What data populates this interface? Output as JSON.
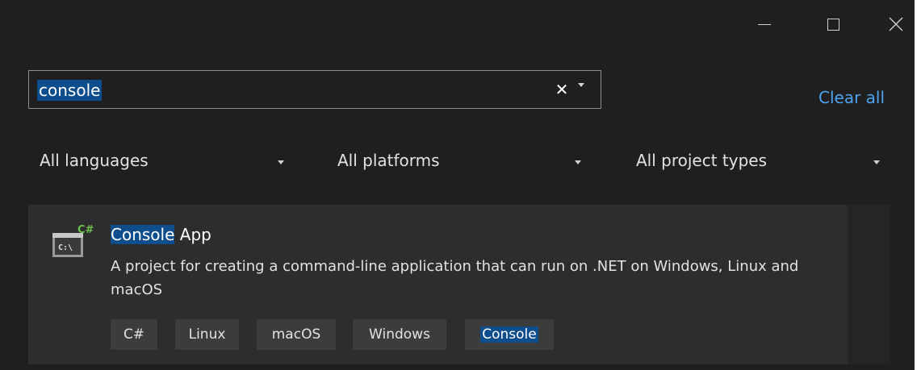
{
  "search": {
    "value": "console",
    "clear_glyph": "✕"
  },
  "clear_all_label": "Clear all",
  "filters": {
    "languages": "All languages",
    "platforms": "All platforms",
    "project_types": "All project types"
  },
  "result": {
    "title_match": "Console",
    "title_rest": " App",
    "icon_badge": "C#",
    "icon_prompt": "C:\\",
    "description": "A project for creating a command-line application that can run on .NET on Windows, Linux and macOS",
    "tags": [
      "C#",
      "Linux",
      "macOS",
      "Windows",
      "Console"
    ]
  },
  "colors": {
    "background": "#1f1f1f",
    "card": "#2d2d2d",
    "tag": "#3c3c3c",
    "highlight": "#0f4e8c",
    "link": "#4da3ef",
    "csharp_badge": "#6cc04a"
  },
  "icons": {
    "minimize": "minimize-icon",
    "maximize": "maximize-icon",
    "close": "close-icon",
    "app": "console-app-icon"
  }
}
